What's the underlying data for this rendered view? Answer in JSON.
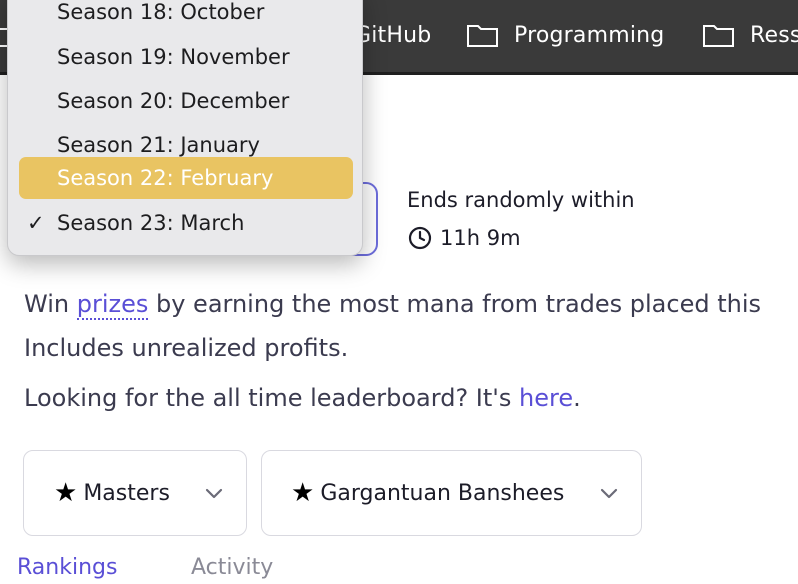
{
  "bookmarks": [
    {
      "label": "GitHub",
      "icon": "folder-icon"
    },
    {
      "label": "Programming",
      "icon": "folder-icon"
    },
    {
      "label": "Ress",
      "icon": "folder-icon"
    }
  ],
  "season_menu": {
    "items": [
      {
        "label": "Season 18: October",
        "state": "normal"
      },
      {
        "label": "Season 19: November",
        "state": "normal"
      },
      {
        "label": "Season 20: December",
        "state": "normal"
      },
      {
        "label": "Season 21: January",
        "state": "normal"
      },
      {
        "label": "Season 22: February",
        "state": "highlighted"
      },
      {
        "label": "Season 23: March",
        "state": "selected"
      }
    ],
    "checkmark": "✓",
    "highlight_color": "#e9c462"
  },
  "ends": {
    "label": "Ends randomly within",
    "time": "11h 9m"
  },
  "description": {
    "win": "Win ",
    "prizes": "prizes",
    "rest": " by earning the most mana from trades placed this",
    "line2": "Includes unrealized profits.",
    "looking": "Looking for the all time leaderboard? It's ",
    "here": "here",
    "period": "."
  },
  "filters": {
    "star": "★",
    "division": "Masters",
    "cohort": "Gargantuan Banshees"
  },
  "tabs": {
    "rankings": "Rankings",
    "activity": "Activity"
  },
  "colors": {
    "accent": "#5a4fd6",
    "bookmarks_bar": "#3a3a3a"
  }
}
